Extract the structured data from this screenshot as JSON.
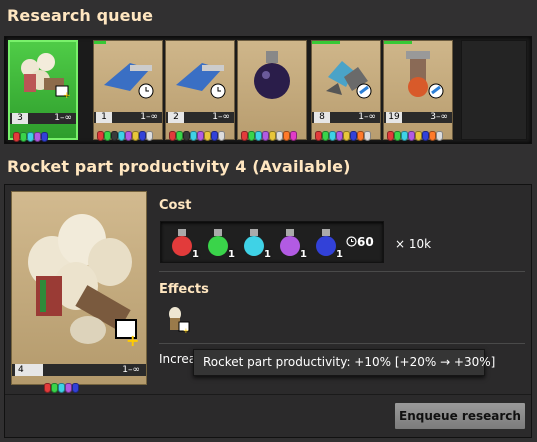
{
  "queue": {
    "title": "Research queue",
    "items": [
      {
        "name": "rocket-part-productivity",
        "level": "3",
        "range": "1–∞",
        "first": true
      },
      {
        "name": "weapon-upgrade-1",
        "level": "1",
        "range": "1–∞"
      },
      {
        "name": "weapon-upgrade-2",
        "level": "2",
        "range": "1–∞"
      },
      {
        "name": "flask-tech",
        "level": "",
        "range": ""
      },
      {
        "name": "mining-productivity",
        "level": "8",
        "range": "1–∞"
      },
      {
        "name": "drill-productivity",
        "level": "19",
        "range": "3–∞"
      }
    ]
  },
  "details": {
    "title": "Rocket part productivity 4 (Available)",
    "card": {
      "level": "4",
      "range": "1–∞"
    },
    "cost_label": "Cost",
    "cost_packs": [
      {
        "color": "#e23b3b",
        "count": "1"
      },
      {
        "color": "#3ad44a",
        "count": "1"
      },
      {
        "color": "#3fd2e6",
        "count": "1"
      },
      {
        "color": "#b25be3",
        "count": "1"
      },
      {
        "color": "#3241d8",
        "count": "1"
      }
    ],
    "time": "60",
    "multiplier": "× 10k",
    "effects_label": "Effects",
    "increase_text": "Increa",
    "tooltip": "Rocket part productivity: +10% [+20% → +30%]",
    "enqueue_label": "Enqueue research"
  },
  "colors": {
    "accent_green": "#37c935",
    "heading": "#ffe6c0"
  }
}
